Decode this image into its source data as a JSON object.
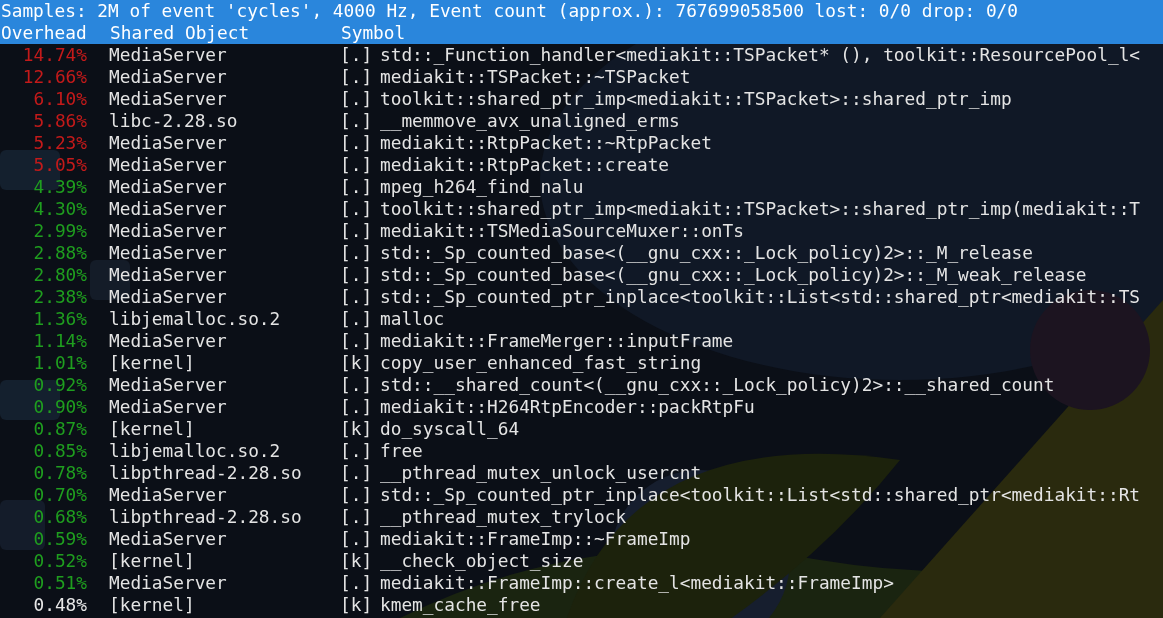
{
  "status_line": "Samples: 2M of event 'cycles', 4000 Hz, Event count (approx.): 767699058500 lost: 0/0 drop: 0/0",
  "columns": [
    "Overhead",
    "Shared Object",
    "Symbol"
  ],
  "rows": [
    {
      "overhead": "14.74%",
      "color": "#c41a1a",
      "object": "MediaServer",
      "mode": "[.]",
      "symbol": "std::_Function_handler<mediakit::TSPacket* (), toolkit::ResourcePool_l<"
    },
    {
      "overhead": "12.66%",
      "color": "#c41a1a",
      "object": "MediaServer",
      "mode": "[.]",
      "symbol": "mediakit::TSPacket::~TSPacket"
    },
    {
      "overhead": "6.10%",
      "color": "#c41a1a",
      "object": "MediaServer",
      "mode": "[.]",
      "symbol": "toolkit::shared_ptr_imp<mediakit::TSPacket>::shared_ptr_imp"
    },
    {
      "overhead": "5.86%",
      "color": "#c41a1a",
      "object": "libc-2.28.so",
      "mode": "[.]",
      "symbol": "__memmove_avx_unaligned_erms"
    },
    {
      "overhead": "5.23%",
      "color": "#c41a1a",
      "object": "MediaServer",
      "mode": "[.]",
      "symbol": "mediakit::RtpPacket::~RtpPacket"
    },
    {
      "overhead": "5.05%",
      "color": "#c41a1a",
      "object": "MediaServer",
      "mode": "[.]",
      "symbol": "mediakit::RtpPacket::create"
    },
    {
      "overhead": "4.39%",
      "color": "#1f9e1f",
      "object": "MediaServer",
      "mode": "[.]",
      "symbol": "mpeg_h264_find_nalu"
    },
    {
      "overhead": "4.30%",
      "color": "#1f9e1f",
      "object": "MediaServer",
      "mode": "[.]",
      "symbol": "toolkit::shared_ptr_imp<mediakit::TSPacket>::shared_ptr_imp(mediakit::T"
    },
    {
      "overhead": "2.99%",
      "color": "#1f9e1f",
      "object": "MediaServer",
      "mode": "[.]",
      "symbol": "mediakit::TSMediaSourceMuxer::onTs"
    },
    {
      "overhead": "2.88%",
      "color": "#1f9e1f",
      "object": "MediaServer",
      "mode": "[.]",
      "symbol": "std::_Sp_counted_base<(__gnu_cxx::_Lock_policy)2>::_M_release"
    },
    {
      "overhead": "2.80%",
      "color": "#1f9e1f",
      "object": "MediaServer",
      "mode": "[.]",
      "symbol": "std::_Sp_counted_base<(__gnu_cxx::_Lock_policy)2>::_M_weak_release"
    },
    {
      "overhead": "2.38%",
      "color": "#1f9e1f",
      "object": "MediaServer",
      "mode": "[.]",
      "symbol": "std::_Sp_counted_ptr_inplace<toolkit::List<std::shared_ptr<mediakit::TS"
    },
    {
      "overhead": "1.36%",
      "color": "#1f9e1f",
      "object": "libjemalloc.so.2",
      "mode": "[.]",
      "symbol": "malloc"
    },
    {
      "overhead": "1.14%",
      "color": "#1f9e1f",
      "object": "MediaServer",
      "mode": "[.]",
      "symbol": "mediakit::FrameMerger::inputFrame"
    },
    {
      "overhead": "1.01%",
      "color": "#1f9e1f",
      "object": "[kernel]",
      "mode": "[k]",
      "symbol": "copy_user_enhanced_fast_string"
    },
    {
      "overhead": "0.92%",
      "color": "#1f9e1f",
      "object": "MediaServer",
      "mode": "[.]",
      "symbol": "std::__shared_count<(__gnu_cxx::_Lock_policy)2>::__shared_count"
    },
    {
      "overhead": "0.90%",
      "color": "#1f9e1f",
      "object": "MediaServer",
      "mode": "[.]",
      "symbol": "mediakit::H264RtpEncoder::packRtpFu"
    },
    {
      "overhead": "0.87%",
      "color": "#1f9e1f",
      "object": "[kernel]",
      "mode": "[k]",
      "symbol": "do_syscall_64"
    },
    {
      "overhead": "0.85%",
      "color": "#1f9e1f",
      "object": "libjemalloc.so.2",
      "mode": "[.]",
      "symbol": "free"
    },
    {
      "overhead": "0.78%",
      "color": "#1f9e1f",
      "object": "libpthread-2.28.so",
      "mode": "[.]",
      "symbol": "__pthread_mutex_unlock_usercnt"
    },
    {
      "overhead": "0.70%",
      "color": "#1f9e1f",
      "object": "MediaServer",
      "mode": "[.]",
      "symbol": "std::_Sp_counted_ptr_inplace<toolkit::List<std::shared_ptr<mediakit::Rt"
    },
    {
      "overhead": "0.68%",
      "color": "#1f9e1f",
      "object": "libpthread-2.28.so",
      "mode": "[.]",
      "symbol": "__pthread_mutex_trylock"
    },
    {
      "overhead": "0.59%",
      "color": "#1f9e1f",
      "object": "MediaServer",
      "mode": "[.]",
      "symbol": "mediakit::FrameImp::~FrameImp"
    },
    {
      "overhead": "0.52%",
      "color": "#1f9e1f",
      "object": "[kernel]",
      "mode": "[k]",
      "symbol": "__check_object_size"
    },
    {
      "overhead": "0.51%",
      "color": "#1f9e1f",
      "object": "MediaServer",
      "mode": "[.]",
      "symbol": "mediakit::FrameImp::create_l<mediakit::FrameImp>"
    },
    {
      "overhead": "0.48%",
      "color": "#e8e8e8",
      "object": "[kernel]",
      "mode": "[k]",
      "symbol": "kmem_cache_free"
    }
  ]
}
